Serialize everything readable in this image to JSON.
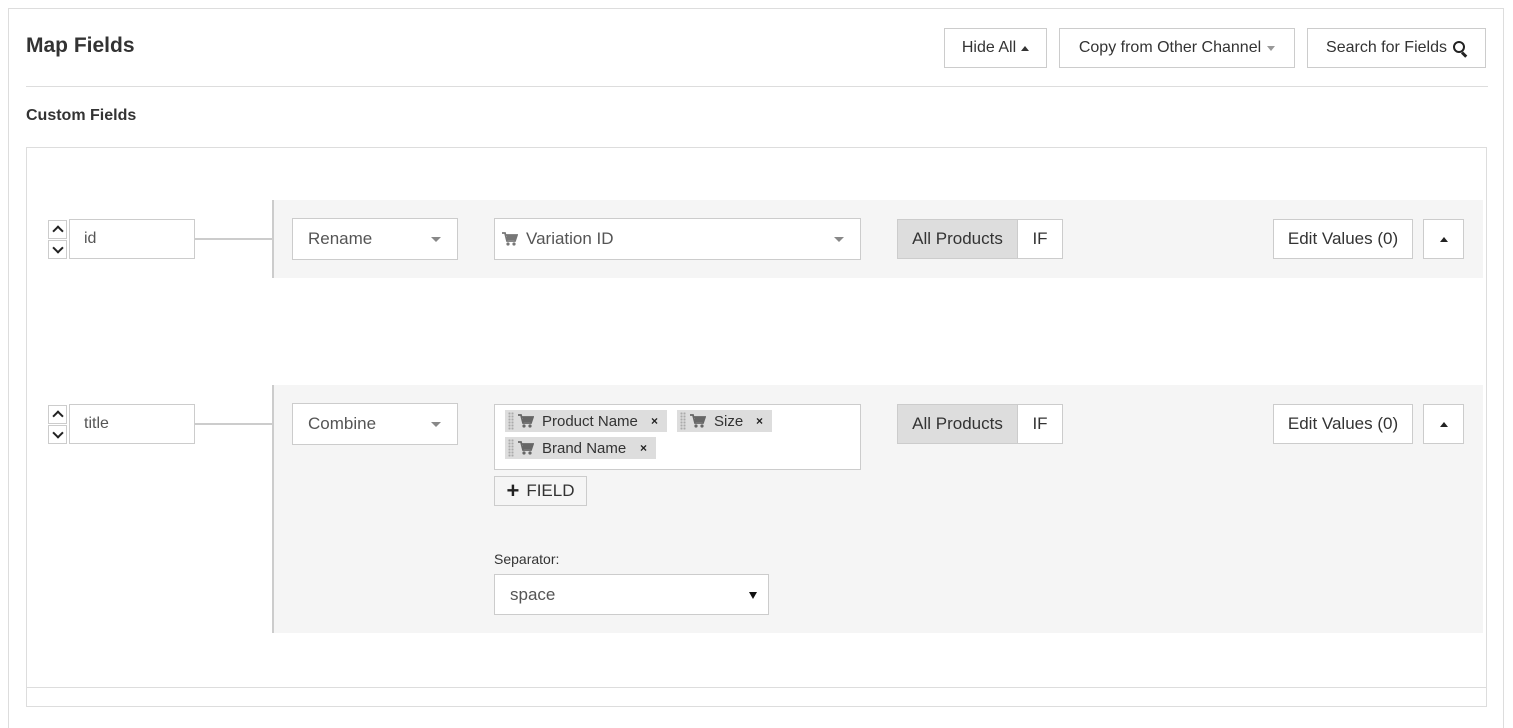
{
  "header": {
    "title": "Map Fields",
    "hide_all_label": "Hide All",
    "copy_label": "Copy from Other Channel",
    "search_label": "Search for Fields"
  },
  "section": {
    "title": "Custom Fields"
  },
  "rows": [
    {
      "name": "id",
      "action": "Rename",
      "source": "Variation ID",
      "scope_all": "All Products",
      "scope_if": "IF",
      "edit_label": "Edit Values (0)"
    },
    {
      "name": "title",
      "action": "Combine",
      "tags": [
        "Product Name",
        "Size",
        "Brand Name"
      ],
      "tag_remove": "×",
      "add_field_label": "FIELD",
      "separator_label": "Separator:",
      "separator_value": "space",
      "scope_all": "All Products",
      "scope_if": "IF",
      "edit_label": "Edit Values (0)"
    }
  ],
  "icons": {
    "cart": "cart-icon",
    "search": "search-icon",
    "caret_up": "caret-up-icon",
    "caret_down": "caret-down-icon"
  },
  "colors": {
    "row_background": "#f5f5f5",
    "active_segment": "#dddddd",
    "border": "#cccccc"
  }
}
